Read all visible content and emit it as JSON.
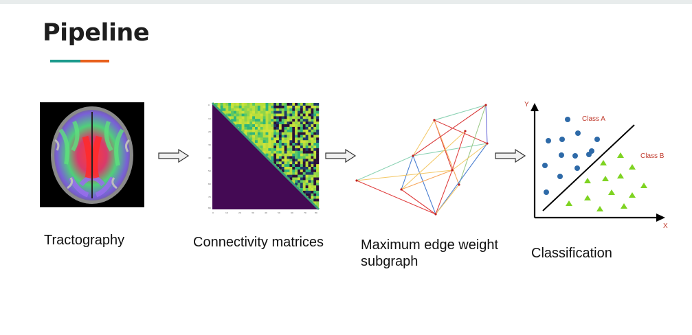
{
  "title": "Pipeline",
  "colors": {
    "accent_teal": "#1c9a8c",
    "accent_orange": "#e8601c"
  },
  "steps": [
    {
      "label": "Tractography",
      "image": "brain-tractography-image"
    },
    {
      "label": "Connectivity matrices",
      "image": "connectivity-matrix-heatmap"
    },
    {
      "label": "Maximum edge weight subgraph",
      "image": "weighted-graph"
    },
    {
      "label": "Classification",
      "image": "classification-scatter-plot"
    }
  ],
  "classification": {
    "y_axis_label": "Y",
    "x_axis_label": "X",
    "class_a_label": "Class A",
    "class_b_label": "Class B"
  }
}
